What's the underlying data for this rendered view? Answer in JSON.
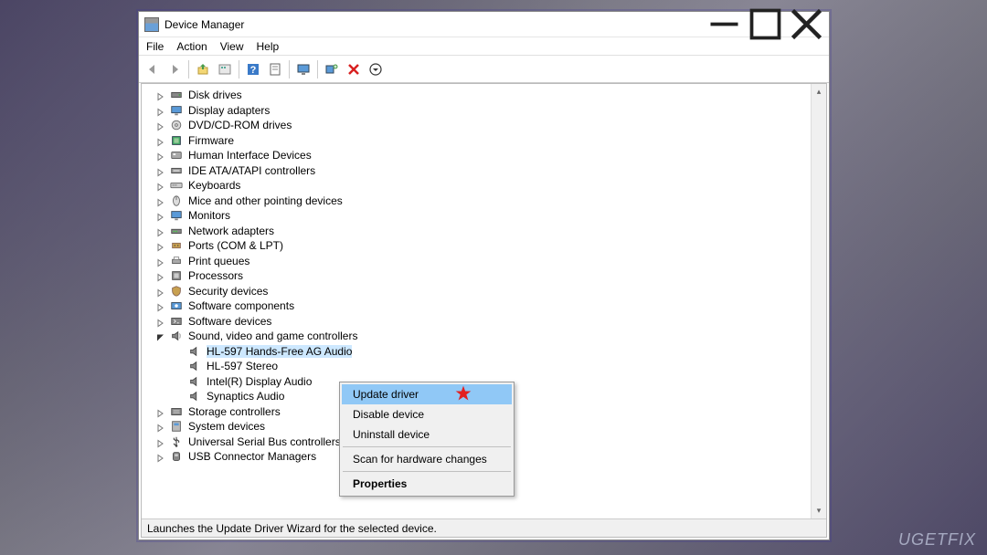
{
  "window": {
    "title": "Device Manager"
  },
  "menu": {
    "file": "File",
    "action": "Action",
    "view": "View",
    "help": "Help"
  },
  "toolbar": {
    "back": "back-arrow",
    "forward": "forward-arrow",
    "up": "up-level",
    "show_hidden": "show-hidden",
    "help": "help",
    "properties": "properties",
    "display": "display",
    "scan": "scan-hardware",
    "remove": "remove",
    "action": "action-menu"
  },
  "tree": {
    "items": [
      {
        "label": "Disk drives",
        "icon": "disk"
      },
      {
        "label": "Display adapters",
        "icon": "display"
      },
      {
        "label": "DVD/CD-ROM drives",
        "icon": "dvd"
      },
      {
        "label": "Firmware",
        "icon": "firmware"
      },
      {
        "label": "Human Interface Devices",
        "icon": "hid"
      },
      {
        "label": "IDE ATA/ATAPI controllers",
        "icon": "ide"
      },
      {
        "label": "Keyboards",
        "icon": "keyboard"
      },
      {
        "label": "Mice and other pointing devices",
        "icon": "mouse"
      },
      {
        "label": "Monitors",
        "icon": "monitor"
      },
      {
        "label": "Network adapters",
        "icon": "network"
      },
      {
        "label": "Ports (COM & LPT)",
        "icon": "port"
      },
      {
        "label": "Print queues",
        "icon": "print"
      },
      {
        "label": "Processors",
        "icon": "cpu"
      },
      {
        "label": "Security devices",
        "icon": "security"
      },
      {
        "label": "Software components",
        "icon": "swcomp"
      },
      {
        "label": "Software devices",
        "icon": "swdev"
      },
      {
        "label": "Sound, video and game controllers",
        "icon": "sound",
        "expanded": true
      },
      {
        "label": "Storage controllers",
        "icon": "storage"
      },
      {
        "label": "System devices",
        "icon": "system"
      },
      {
        "label": "Universal Serial Bus controllers",
        "icon": "usb"
      },
      {
        "label": "USB Connector Managers",
        "icon": "usbconn"
      }
    ],
    "sound_children": [
      {
        "label": "HL-597 Hands-Free AG Audio",
        "selected": true
      },
      {
        "label": "HL-597 Stereo"
      },
      {
        "label": "Intel(R) Display Audio"
      },
      {
        "label": "Synaptics Audio"
      }
    ]
  },
  "context_menu": {
    "update": "Update driver",
    "disable": "Disable device",
    "uninstall": "Uninstall device",
    "scan": "Scan for hardware changes",
    "properties": "Properties"
  },
  "status": {
    "text": "Launches the Update Driver Wizard for the selected device."
  },
  "watermark": "UGETFIX"
}
